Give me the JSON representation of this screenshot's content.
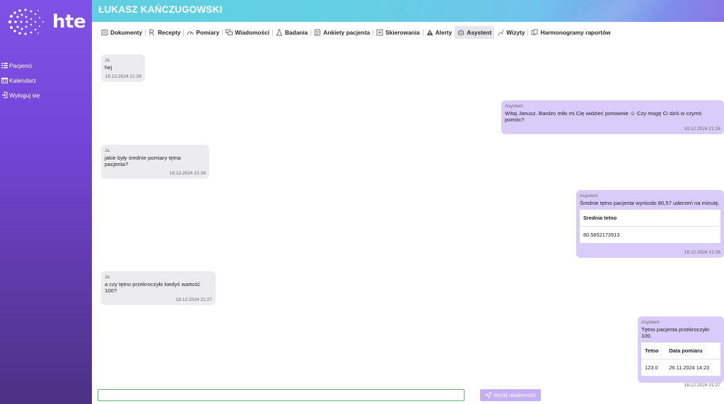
{
  "brand": {
    "name": "hte"
  },
  "sidebar": {
    "items": [
      {
        "label": "Pacjenci",
        "icon": "list-icon"
      },
      {
        "label": "Kalendarz",
        "icon": "calendar-icon"
      },
      {
        "label": "Wyloguj się",
        "icon": "logout-icon"
      }
    ]
  },
  "header": {
    "patient_name": "ŁUKASZ KAŃCZUGOWSKI"
  },
  "tabs": [
    {
      "label": "Dokumenty",
      "icon": "document-icon"
    },
    {
      "label": "Recepty",
      "icon": "prescription-icon"
    },
    {
      "label": "Pomiary",
      "icon": "gauge-icon"
    },
    {
      "label": "Wiadomości",
      "icon": "messages-icon"
    },
    {
      "label": "Badania",
      "icon": "flask-icon"
    },
    {
      "label": "Ankiety pacjenta",
      "icon": "survey-icon"
    },
    {
      "label": "Skierowania",
      "icon": "referral-icon"
    },
    {
      "label": "Alerty",
      "icon": "warning-icon"
    },
    {
      "label": "Asystent",
      "icon": "assistant-icon",
      "active": true
    },
    {
      "label": "Wizyty",
      "icon": "visits-icon"
    },
    {
      "label": "Harmonogramy raportów",
      "icon": "schedule-icon"
    }
  ],
  "messages": [
    {
      "sender": "Ja",
      "text": "hej",
      "time": "18.12.2024 21:26"
    },
    {
      "sender": "Asystent",
      "text": "Witaj Janusz. Bardzo miło mi Cię widzieć ponownie ☺ Czy mogę Ci dziś w czymś pomóc?",
      "time": "18.12.2024 21:26"
    },
    {
      "sender": "Ja",
      "text": "jakie były średnie pomiary tętna pacjenta?",
      "time": "18.12.2024 21:26"
    },
    {
      "sender": "Asystent",
      "text": "Średnie tętno pacjenta wyniosło 80,57 uderzeń na minutę.",
      "time": "18.12.2024 21:26",
      "table": {
        "headers": [
          "Srednia tetno"
        ],
        "rows": [
          [
            "80.5652173913"
          ]
        ]
      }
    },
    {
      "sender": "Ja",
      "text": "a czy tętno przekroczyło kiedyś wartość 100?",
      "time": "18.12.2024 21:27"
    },
    {
      "sender": "Asystent",
      "text": "Tętno pacjenta przekroczyło 100.",
      "time": "18.12.2024 21:27",
      "table": {
        "headers": [
          "Tetno",
          "Data pomiaru"
        ],
        "rows": [
          [
            "123.0",
            "26.11.2024 14:23"
          ]
        ]
      }
    }
  ],
  "composer": {
    "input_value": "",
    "send_label": "Wyślij wiadomość"
  },
  "colors": {
    "accent": "#7f52e6",
    "bot_bubble": "#d9ccfb",
    "user_bubble": "#ececee",
    "header": "#63d0e3"
  }
}
